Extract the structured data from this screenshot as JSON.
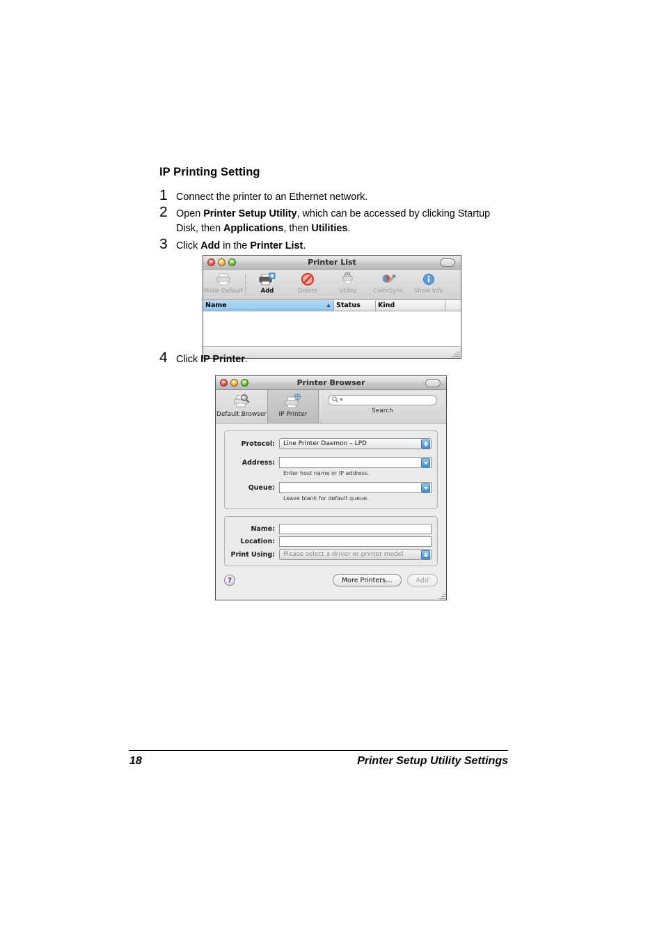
{
  "document": {
    "heading": "IP Printing Setting",
    "steps": [
      {
        "num": "1",
        "html": "Connect the printer to an Ethernet network."
      },
      {
        "num": "2",
        "html": "Open <b>Printer Setup Utility</b>, which can be accessed by clicking Startup Disk, then <b>Applications</b>, then <b>Utilities</b>."
      },
      {
        "num": "3",
        "html": "Click <b>Add</b> in the <b>Printer List</b>."
      },
      {
        "num": "4",
        "html": "Click <b>IP Printer</b>."
      }
    ],
    "footer": {
      "page_number": "18",
      "title": "Printer Setup Utility Settings"
    }
  },
  "printer_list_window": {
    "title": "Printer List",
    "window_controls": [
      "close-button",
      "minimize-button",
      "zoom-button"
    ],
    "toolbar": [
      {
        "label": "Make Default",
        "icon": "printer-icon",
        "enabled": false
      },
      {
        "label": "Add",
        "icon": "printer-add-icon",
        "enabled": true
      },
      {
        "label": "Delete",
        "icon": "no-entry-icon",
        "enabled": false
      },
      {
        "label": "Utility",
        "icon": "printer-wrench-icon",
        "enabled": false
      },
      {
        "label": "ColorSync",
        "icon": "colorsync-icon",
        "enabled": false
      },
      {
        "label": "Show Info",
        "icon": "info-icon",
        "enabled": false
      }
    ],
    "columns": [
      {
        "label": "Name",
        "sorted": true,
        "sort_direction": "ascending"
      },
      {
        "label": "Status",
        "sorted": false
      },
      {
        "label": "Kind",
        "sorted": false
      }
    ],
    "rows": []
  },
  "printer_browser_window": {
    "title": "Printer Browser",
    "tabs": [
      {
        "label": "Default Browser",
        "icon": "printer-magnifier-icon",
        "selected": false
      },
      {
        "label": "IP Printer",
        "icon": "printer-network-icon",
        "selected": true
      }
    ],
    "search": {
      "value": "",
      "placeholder": "",
      "label": "Search",
      "icon": "search-icon"
    },
    "connection_fields": {
      "protocol": {
        "label": "Protocol:",
        "value": "Line Printer Daemon – LPD"
      },
      "address": {
        "label": "Address:",
        "value": "",
        "hint": "Enter host name or IP address."
      },
      "queue": {
        "label": "Queue:",
        "value": "",
        "hint": "Leave blank for default queue."
      }
    },
    "identity_fields": {
      "name": {
        "label": "Name:",
        "value": ""
      },
      "location": {
        "label": "Location:",
        "value": ""
      },
      "print_using": {
        "label": "Print Using:",
        "value": "Please select a driver or printer model",
        "is_placeholder": true
      }
    },
    "buttons": {
      "help": "?",
      "more_printers": "More Printers…",
      "add": "Add",
      "add_enabled": false
    }
  },
  "colors": {
    "accent_blue": "#3f8fd2",
    "sorted_header": "#8ec4ee",
    "window_chrome": "#ededed",
    "traffic_red": "#e24b3f",
    "traffic_yellow": "#f0a92c",
    "traffic_green": "#5cba2e"
  }
}
